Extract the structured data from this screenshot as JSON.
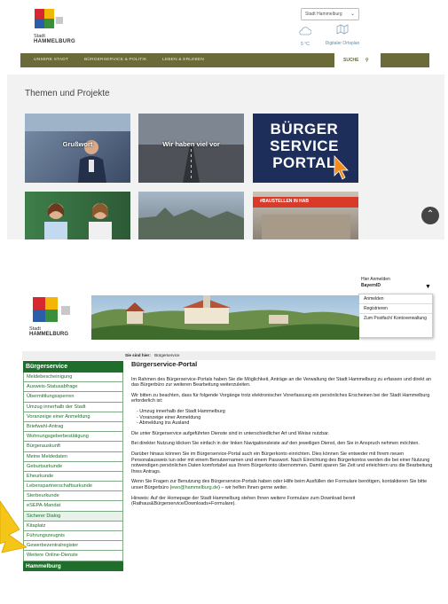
{
  "top": {
    "logo_text": {
      "line1": "Stadt",
      "line2": "HAMMELBURG"
    },
    "city_select": "Stadt Hammelburg",
    "weather": "5 °C",
    "ortsplan": "Digitaler Ortsplan",
    "nav": [
      "UNSERE STADT",
      "BÜRGERSERVICE & POLITIK",
      "LEBEN & ERLEBEN"
    ],
    "search": "SUCHE",
    "section_title": "Themen und Projekte",
    "tiles": [
      {
        "caption": "Grußwort"
      },
      {
        "caption": "Wir haben viel vor"
      },
      {
        "caption": "BÜRGER SERVICE PORTAL"
      },
      {
        "caption": "#BAUSTELLEN IN HAB"
      }
    ]
  },
  "bottom": {
    "login": {
      "line1": "Hier Anmelden",
      "line2": "BayernID"
    },
    "login_menu": [
      "Anmelden",
      "Registrieren",
      "Zum Postfach/ Kontoverwaltung"
    ],
    "logo_text": {
      "line1": "Stadt",
      "line2": "HAMMELBURG"
    },
    "breadcrumb": {
      "label": "Sie sind hier:",
      "value": "Bürgerservice"
    },
    "sidebar": {
      "title": "Bürgerservice",
      "items": [
        "Meldebescheinigung",
        "Ausweis-Statusabfrage",
        "Übermittlungssperren",
        "Umzug innerhalb der Stadt",
        "Voranzeige einer Anmeldung",
        "Briefwahl-Antrag",
        "Wohnungsgeberbestätigung",
        "Bürgerauskunft",
        "Meine Meldedaten",
        "Geburtsurkunde",
        "Eheurkunde",
        "Lebenspartnerschaftsurkunde",
        "Sterbeurkunde",
        "eSEPA-Mandat",
        "Sicherer Dialog",
        "Kitaplatz",
        "Führungszeugnis",
        "Gewerbezentralregister",
        "Weitere Online-Dienste"
      ],
      "footer": "Hammelburg"
    },
    "content": {
      "title": "Bürgerservice-Portal",
      "p1": "Im Rahmen des Bürgerservice-Portals haben Sie die Möglichkeit, Anträge an die Verwaltung der Stadt Hammelburg zu erfassen und direkt an das Bürgerbüro zur weiteren Bearbeitung weiterzuleiten.",
      "p2": "Wir bitten zu beachten, dass für folgende Vorgänge trotz elektronischer Vorerfassung ein persönliches Erscheinen bei der Stadt Hammelburg erforderlich ist:",
      "list": [
        "- Umzug innerhalb der Stadt Hammelburg",
        "- Voranzeige einer Anmeldung",
        "- Abmeldung ins Ausland"
      ],
      "p3": "Die unter Bürgerservice aufgeführten Dienste sind in unterschiedlicher Art und Weise nutzbar.",
      "p4": "Bei direkter Nutzung klicken Sie einfach in der linken Navigationsleiste auf den jeweiligen Dienst, den Sie in Anspruch nehmen möchten.",
      "p5": "Darüber hinaus können Sie im Bürgerservice-Portal auch ein Bürgerkonto einrichten. Dies können Sie entweder mit Ihrem neuen Personalausweis tun oder mit einem Benutzernamen und einem Passwort. Nach Einrichtung des Bürgerkontos werden die bei einer Nutzung notwendigen persönlichen Daten komfortabel aus Ihrem Bürgerkonto übernommen. Damit sparen Sie Zeit und erleichtern uns die Bearbeitung Ihres Antrags.",
      "p6_pre": "Wenn Sie Fragen zur Benutzung des Bürgerservice-Portals haben oder Hilfe beim Ausfüllen der Formulare benötigen, kontaktieren Sie bitte unser Bürgerbüro (",
      "p6_link": "ewo@hammelburg.de",
      "p6_post": ") – wir helfen Ihnen gerne weiter.",
      "p7": "Hinweis: Auf der Homepage der Stadt Hammelburg stehen Ihnen weitere Formulare zum Download bereit (Rathaus&Bürgerservice/Downloads+Formulare)."
    }
  },
  "colors": {
    "olive_nav": "#6b6b3a",
    "green": "#1f6e2c",
    "arrow_yellow": "#f5c518"
  }
}
